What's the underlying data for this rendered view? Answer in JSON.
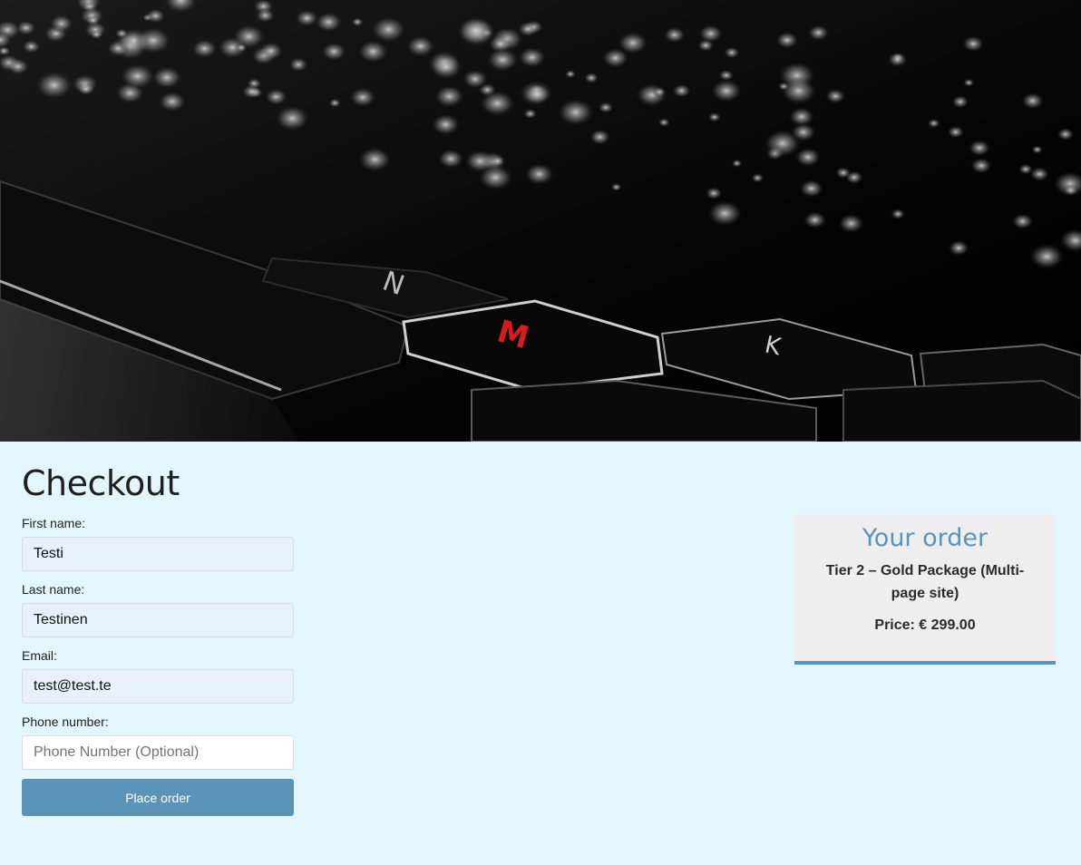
{
  "hero": {
    "key_letter": "M"
  },
  "checkout": {
    "title": "Checkout",
    "fields": [
      {
        "label": "First name:",
        "value": "Testi",
        "placeholder": ""
      },
      {
        "label": "Last name:",
        "value": "Testinen",
        "placeholder": ""
      },
      {
        "label": "Email:",
        "value": "test@test.te",
        "placeholder": ""
      },
      {
        "label": "Phone number:",
        "value": "",
        "placeholder": "Phone Number (Optional)"
      }
    ],
    "submit_label": "Place order"
  },
  "order": {
    "title": "Your order",
    "item": "Tier 2 – Gold Package (Multi-page site)",
    "price": "Price: € 299.00"
  },
  "colors": {
    "page_background": "#e3f6fd",
    "accent": "#5b93b9",
    "order_box": "#eeeeee",
    "key_letter": "#d81b1b"
  }
}
